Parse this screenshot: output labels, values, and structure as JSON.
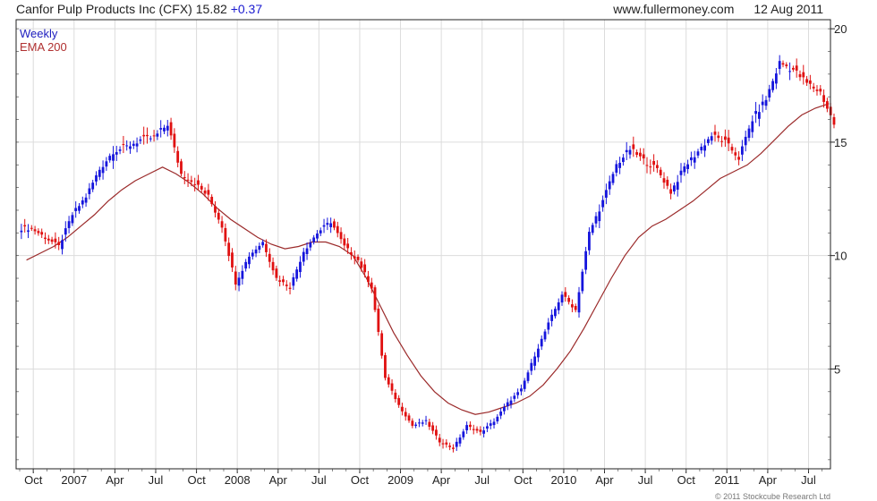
{
  "header": {
    "title": "Canfor Pulp Products Inc (CFX)",
    "price": "15.82",
    "change": "+0.37",
    "source": "www.fullermoney.com",
    "date": "12 Aug 2011"
  },
  "legend": {
    "weekly": "Weekly",
    "ema": "EMA 200"
  },
  "copyright": "© 2011 Stockcube Research Ltd",
  "colors": {
    "up": "#1515dd",
    "down": "#e01010",
    "ema": "#9b2a2a",
    "grid": "#dcdcdc",
    "frame": "#222222"
  },
  "chart_data": {
    "type": "line",
    "title": "Canfor Pulp Products Inc (CFX)",
    "xlabel": "",
    "ylabel": "",
    "ylim": [
      0.6,
      20.4
    ],
    "y_ticks": [
      5,
      10,
      15,
      20
    ],
    "x_ticks": [
      "Oct",
      "2007",
      "Apr",
      "Jul",
      "Oct",
      "2008",
      "Apr",
      "Jul",
      "Oct",
      "2009",
      "Apr",
      "Jul",
      "Oct",
      "2010",
      "Apr",
      "Jul",
      "Oct",
      "2011",
      "Apr",
      "Jul"
    ],
    "grid": true,
    "legend_position": "top-left",
    "series": [
      {
        "name": "Weekly",
        "style": "candlestick (blue = up week, red = down week)",
        "x": [
          "2006-09",
          "2006-10",
          "2006-11",
          "2006-12",
          "2007-01",
          "2007-02",
          "2007-03",
          "2007-04",
          "2007-05",
          "2007-06",
          "2007-07",
          "2007-08",
          "2007-09",
          "2007-10",
          "2007-11",
          "2007-12",
          "2008-01",
          "2008-02",
          "2008-03",
          "2008-04",
          "2008-05",
          "2008-06",
          "2008-07",
          "2008-08",
          "2008-09",
          "2008-10",
          "2008-11",
          "2008-12",
          "2009-01",
          "2009-02",
          "2009-03",
          "2009-04",
          "2009-05",
          "2009-06",
          "2009-07",
          "2009-08",
          "2009-09",
          "2009-10",
          "2009-11",
          "2009-12",
          "2010-01",
          "2010-02",
          "2010-03",
          "2010-04",
          "2010-05",
          "2010-06",
          "2010-07",
          "2010-08",
          "2010-09",
          "2010-10",
          "2010-11",
          "2010-12",
          "2011-01",
          "2011-02",
          "2011-03",
          "2011-04",
          "2011-05",
          "2011-06",
          "2011-07",
          "2011-08"
        ],
        "values": [
          11.2,
          10.8,
          10.4,
          11.8,
          12.6,
          13.8,
          14.6,
          14.8,
          15.1,
          15.2,
          15.8,
          13.6,
          13.2,
          12.6,
          11.3,
          8.8,
          10.0,
          10.6,
          9.0,
          8.6,
          10.2,
          11.0,
          11.5,
          10.4,
          9.8,
          8.6,
          4.6,
          3.4,
          2.5,
          2.7,
          1.8,
          1.5,
          2.5,
          2.2,
          2.7,
          3.5,
          4.1,
          5.6,
          7.0,
          8.3,
          7.6,
          11.0,
          12.4,
          14.0,
          14.7,
          14.2,
          13.8,
          12.8,
          13.9,
          14.6,
          15.3,
          15.0,
          14.3,
          16.0,
          16.9,
          18.5,
          18.2,
          17.6,
          17.2,
          15.8
        ]
      },
      {
        "name": "EMA 200",
        "x": [
          "2006-09",
          "2006-10",
          "2006-11",
          "2006-12",
          "2007-01",
          "2007-02",
          "2007-03",
          "2007-04",
          "2007-05",
          "2007-06",
          "2007-07",
          "2007-08",
          "2007-09",
          "2007-10",
          "2007-11",
          "2007-12",
          "2008-01",
          "2008-02",
          "2008-03",
          "2008-04",
          "2008-05",
          "2008-06",
          "2008-07",
          "2008-08",
          "2008-09",
          "2008-10",
          "2008-11",
          "2008-12",
          "2009-01",
          "2009-02",
          "2009-03",
          "2009-04",
          "2009-05",
          "2009-06",
          "2009-07",
          "2009-08",
          "2009-09",
          "2009-10",
          "2009-11",
          "2009-12",
          "2010-01",
          "2010-02",
          "2010-03",
          "2010-04",
          "2010-05",
          "2010-06",
          "2010-07",
          "2010-08",
          "2010-09",
          "2010-10",
          "2010-11",
          "2010-12",
          "2011-01",
          "2011-02",
          "2011-03",
          "2011-04",
          "2011-05",
          "2011-06",
          "2011-07",
          "2011-08"
        ],
        "values": [
          9.8,
          10.1,
          10.4,
          10.8,
          11.3,
          11.8,
          12.4,
          12.9,
          13.3,
          13.6,
          13.9,
          13.6,
          13.2,
          12.7,
          12.1,
          11.6,
          11.2,
          10.8,
          10.5,
          10.3,
          10.4,
          10.6,
          10.6,
          10.4,
          10.0,
          9.0,
          7.8,
          6.6,
          5.6,
          4.7,
          4.0,
          3.5,
          3.2,
          3.0,
          3.1,
          3.3,
          3.5,
          3.8,
          4.3,
          5.0,
          5.8,
          6.8,
          7.9,
          9.0,
          10.0,
          10.8,
          11.3,
          11.6,
          12.0,
          12.4,
          12.9,
          13.4,
          13.7,
          14.0,
          14.5,
          15.1,
          15.7,
          16.2,
          16.5,
          16.7
        ]
      }
    ]
  }
}
